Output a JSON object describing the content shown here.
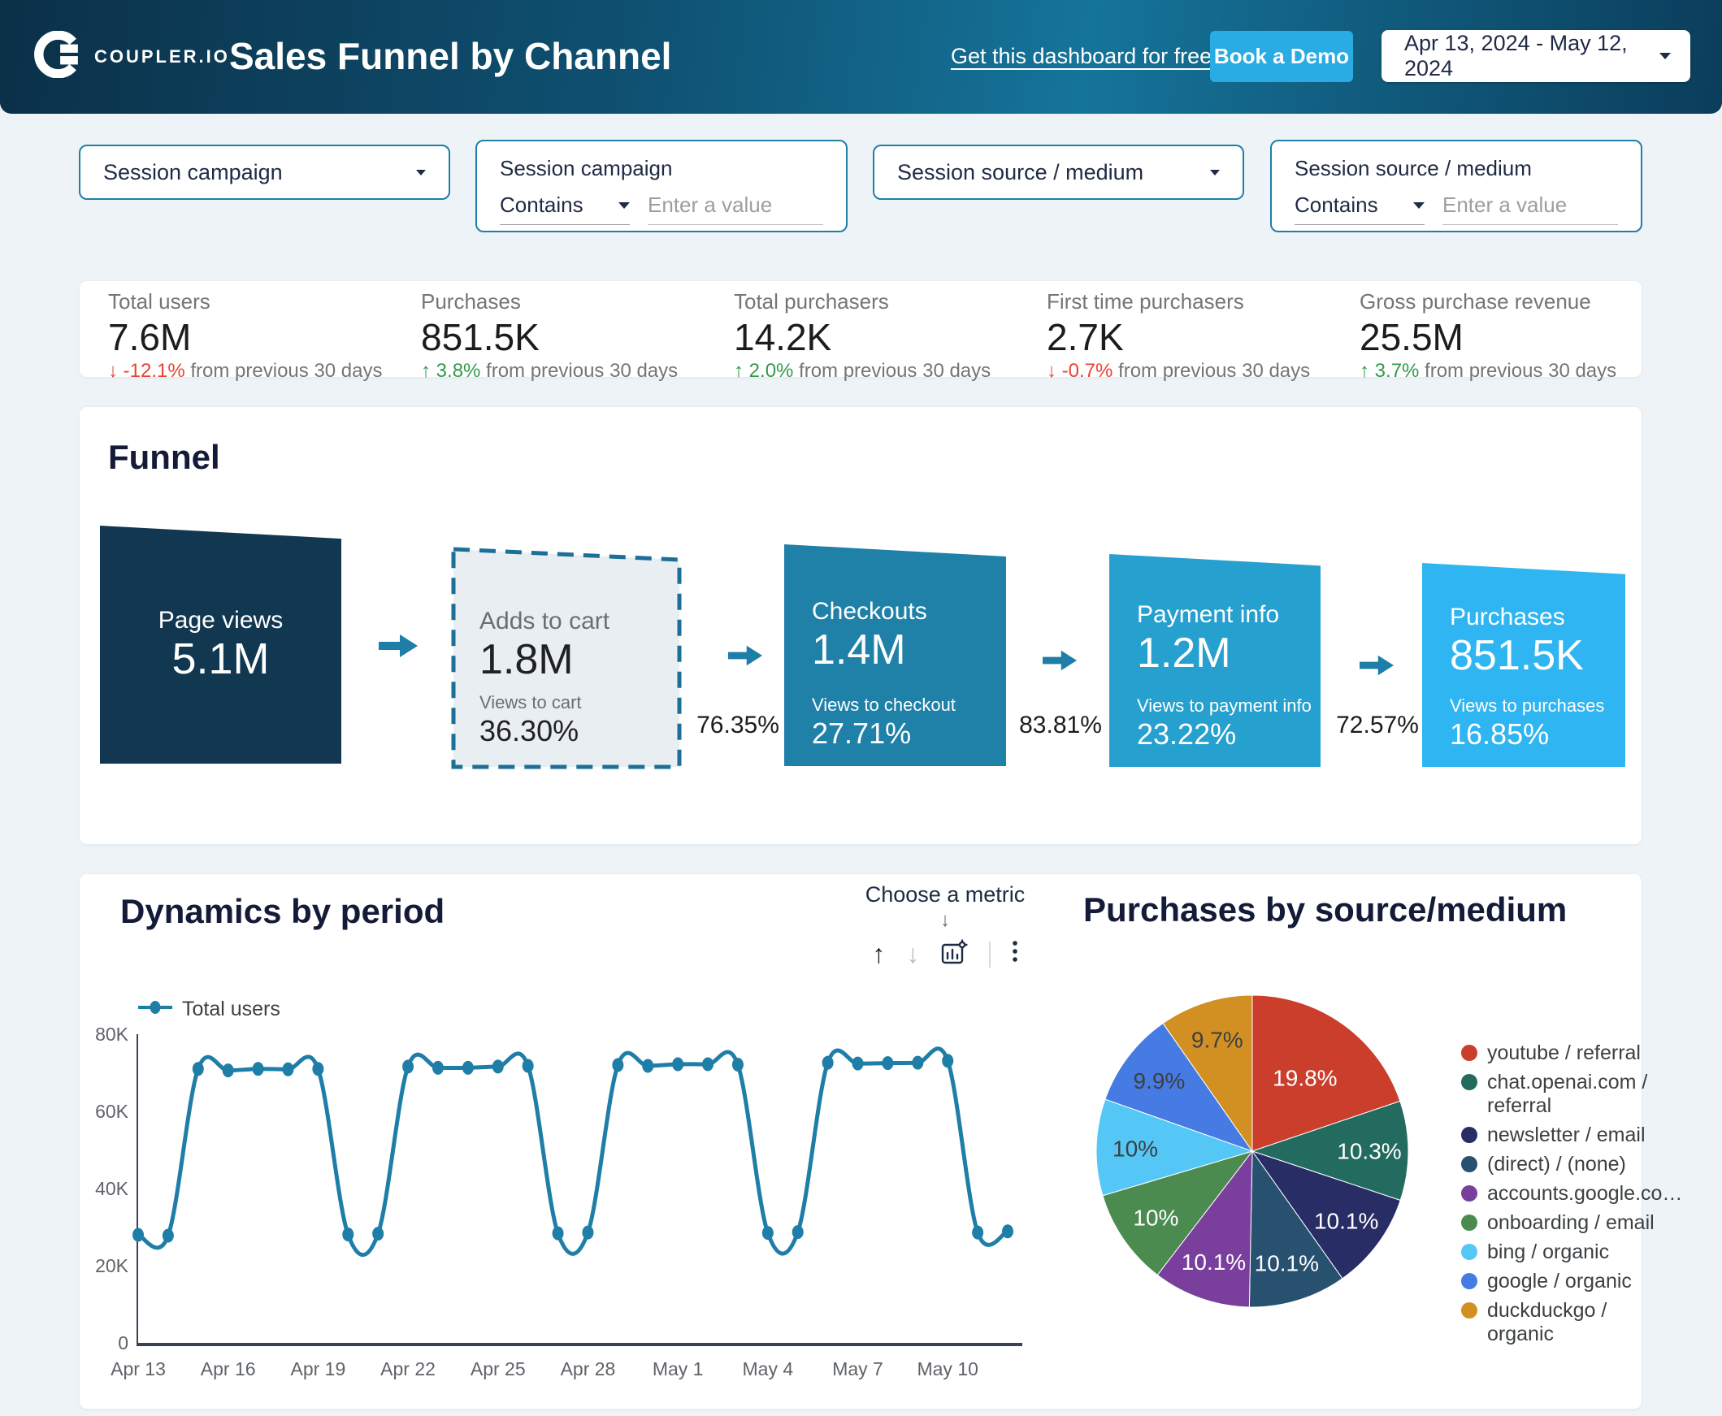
{
  "header": {
    "logo_text": "COUPLER.IO",
    "title": "Sales Funnel by Channel",
    "link": "Get this dashboard for free",
    "demo_button": "Book a Demo",
    "date_range": "Apr 13, 2024 - May 12, 2024"
  },
  "colors": {
    "accent_teal": "#1e7ea7",
    "demo_button_bg": "#29ace4",
    "positive": "#319a4d",
    "negative": "#e94235",
    "page_bg": "#edf3f7",
    "filter_border": "#1f7fa7",
    "title_navy": "#141b38"
  },
  "icons": {
    "up_arrow": "↑",
    "down_arrow": "↓",
    "choose_metric_down": "↓"
  },
  "filters": {
    "select1": {
      "label": "Session campaign"
    },
    "combo1": {
      "label": "Session campaign",
      "operator": "Contains",
      "placeholder": "Enter a value"
    },
    "select2": {
      "label": "Session source / medium"
    },
    "combo2": {
      "label": "Session source / medium",
      "operator": "Contains",
      "placeholder": "Enter a value"
    }
  },
  "kpis": {
    "items": [
      {
        "label": "Total users",
        "value": "7.6M",
        "arrow": "↓",
        "delta": "-12.1%",
        "suffix": " from previous 30 days",
        "color": "#e94235"
      },
      {
        "label": "Purchases",
        "value": "851.5K",
        "arrow": "↑",
        "delta": "3.8%",
        "suffix": " from previous 30 days",
        "color": "#319a4d"
      },
      {
        "label": "Total purchasers",
        "value": "14.2K",
        "arrow": "↑",
        "delta": "2.0%",
        "suffix": " from previous 30 days",
        "color": "#319a4d"
      },
      {
        "label": "First time purchasers",
        "value": "2.7K",
        "arrow": "↓",
        "delta": "-0.7%",
        "suffix": " from previous 30 days",
        "color": "#e94235"
      },
      {
        "label": "Gross purchase revenue",
        "value": "25.5M",
        "arrow": "↑",
        "delta": "3.7%",
        "suffix": " from previous 30 days",
        "color": "#319a4d"
      }
    ]
  },
  "funnel": {
    "title": "Funnel",
    "steps": [
      {
        "label": "Page views",
        "value": "5.1M",
        "color": "#123750"
      },
      {
        "label": "Adds to cart",
        "value": "1.8M",
        "ratio_label": "Views to cart",
        "ratio": "36.30%",
        "color": "#e9eef3",
        "border": "#1c6f96",
        "selected": true
      },
      {
        "label": "Checkouts",
        "value": "1.4M",
        "ratio_label": "Views to checkout",
        "ratio": "27.71%",
        "color": "#1f80a8"
      },
      {
        "label": "Payment info",
        "value": "1.2M",
        "ratio_label": "Views to payment info",
        "ratio": "23.22%",
        "color": "#25a0cf"
      },
      {
        "label": "Purchases",
        "value": "851.5K",
        "ratio_label": "Views to purchases",
        "ratio": "16.85%",
        "color": "#2fb5f1"
      }
    ],
    "transition_rates": [
      "76.35%",
      "83.81%",
      "72.57%"
    ]
  },
  "dynamics": {
    "title": "Dynamics by period",
    "choose_metric": "Choose a metric",
    "legend": "Total users"
  },
  "pie_section": {
    "title": "Purchases by source/medium"
  },
  "chart_data": [
    {
      "type": "line",
      "title": "Dynamics by period",
      "x": [
        "Apr 13",
        "Apr 14",
        "Apr 15",
        "Apr 16",
        "Apr 17",
        "Apr 18",
        "Apr 19",
        "Apr 20",
        "Apr 21",
        "Apr 22",
        "Apr 23",
        "Apr 24",
        "Apr 25",
        "Apr 26",
        "Apr 27",
        "Apr 28",
        "Apr 29",
        "Apr 30",
        "May 1",
        "May 2",
        "May 3",
        "May 4",
        "May 5",
        "May 6",
        "May 7",
        "May 8",
        "May 9",
        "May 10",
        "May 11",
        "May 12"
      ],
      "tick_every": 3,
      "series": [
        {
          "name": "Total users",
          "color": "#1e7ea7",
          "values": [
            28000,
            27800,
            71000,
            70600,
            71000,
            70900,
            71000,
            28100,
            28300,
            71600,
            71300,
            71300,
            71600,
            71800,
            28400,
            28600,
            72000,
            71800,
            72200,
            72200,
            72100,
            28500,
            28700,
            72600,
            72400,
            72500,
            72600,
            73100,
            28600,
            28900
          ]
        }
      ],
      "ylim": [
        0,
        80000
      ],
      "yticks": [
        {
          "v": 0,
          "label": "0"
        },
        {
          "v": 20000,
          "label": "20K"
        },
        {
          "v": 40000,
          "label": "40K"
        },
        {
          "v": 60000,
          "label": "60K"
        },
        {
          "v": 80000,
          "label": "80K"
        }
      ],
      "grid": false,
      "legend_position": "top-left"
    },
    {
      "type": "pie",
      "title": "Purchases by source/medium",
      "labels": [
        "youtube / referral",
        "chat.openai.com / referral",
        "newsletter / email",
        "(direct) / (none)",
        "accounts.google.co…",
        "onboarding / email",
        "bing / organic",
        "google / organic",
        "duckduckgo / organic"
      ],
      "values": [
        19.8,
        10.3,
        10.1,
        10.1,
        10.1,
        10,
        10,
        9.9,
        9.7
      ],
      "display": [
        "19.8%",
        "10.3%",
        "10.1%",
        "10.1%",
        "10.1%",
        "10%",
        "10%",
        "9.9%",
        "9.7%"
      ],
      "colors": [
        "#cb3e2c",
        "#226b5e",
        "#282d66",
        "#28506f",
        "#7a3e9d",
        "#4c8b50",
        "#54c7f6",
        "#477be4",
        "#d29023"
      ],
      "label_dark": [
        false,
        false,
        false,
        false,
        false,
        false,
        true,
        true,
        true
      ],
      "legend_position": "right",
      "start_angle": 0
    }
  ]
}
